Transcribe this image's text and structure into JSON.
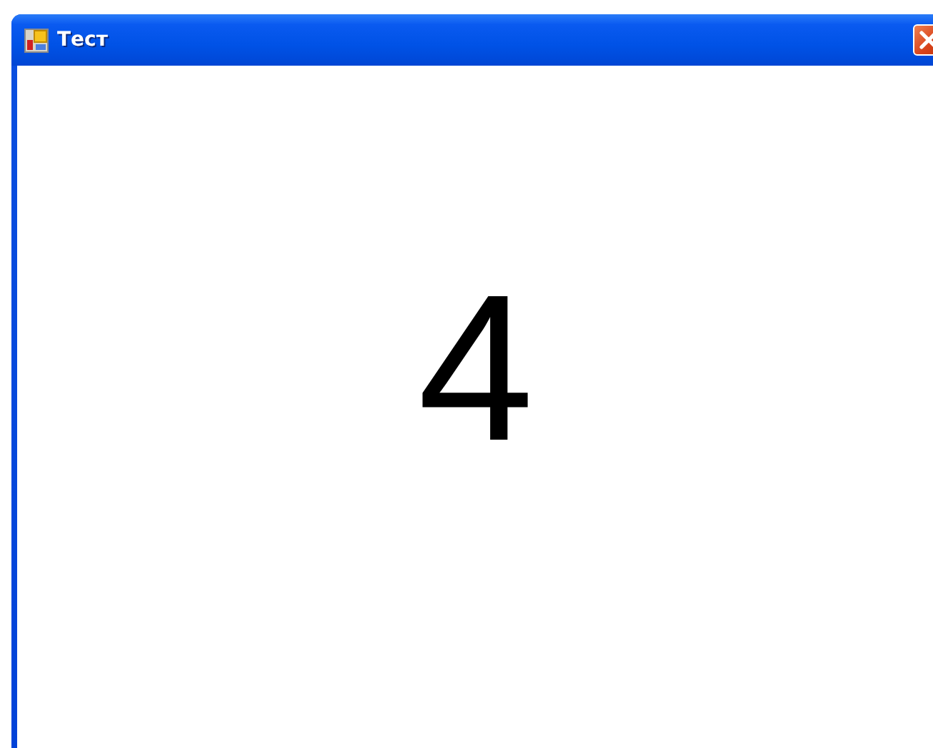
{
  "window": {
    "title": "Тест"
  },
  "content": {
    "value": "4"
  }
}
